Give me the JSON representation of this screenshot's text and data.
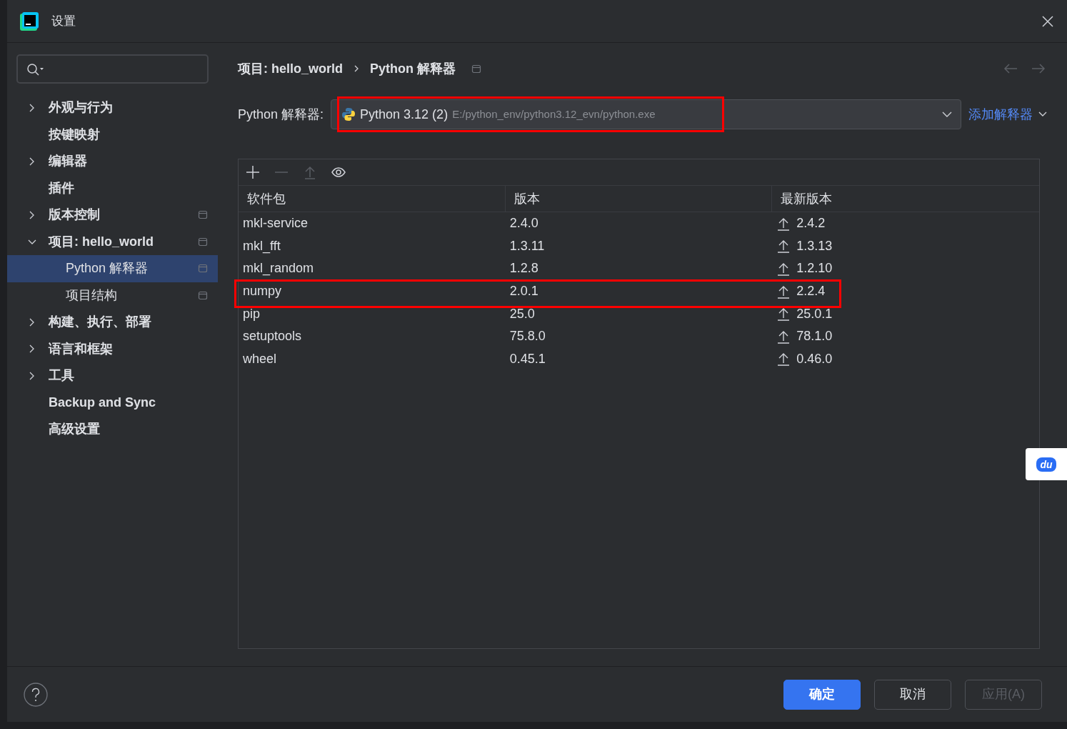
{
  "window": {
    "title": "设置"
  },
  "sidebar": {
    "items": [
      {
        "label": "外观与行为",
        "expanded": false,
        "selected": false,
        "scoped": false
      },
      {
        "label": "按键映射",
        "selected": false,
        "scoped": false
      },
      {
        "label": "编辑器",
        "expanded": false,
        "selected": false,
        "scoped": false
      },
      {
        "label": "插件",
        "selected": false,
        "scoped": false
      },
      {
        "label": "版本控制",
        "expanded": false,
        "selected": false,
        "scoped": true
      },
      {
        "label": "项目: hello_world",
        "expanded": true,
        "selected": false,
        "scoped": true,
        "children": [
          {
            "label": "Python 解释器",
            "selected": true,
            "scoped": true
          },
          {
            "label": "项目结构",
            "selected": false,
            "scoped": true
          }
        ]
      },
      {
        "label": "构建、执行、部署",
        "expanded": false,
        "selected": false,
        "scoped": false
      },
      {
        "label": "语言和框架",
        "expanded": false,
        "selected": false,
        "scoped": false
      },
      {
        "label": "工具",
        "expanded": false,
        "selected": false,
        "scoped": false
      },
      {
        "label": "Backup and Sync",
        "selected": false,
        "scoped": false
      },
      {
        "label": "高级设置",
        "selected": false,
        "scoped": false
      }
    ]
  },
  "breadcrumb": [
    "项目: hello_world",
    "Python 解释器"
  ],
  "interpreter": {
    "label": "Python 解释器:",
    "name": "Python 3.12 (2)",
    "path": "E:/python_env/python3.12_evn/python.exe",
    "highlighted": true,
    "add_link": "添加解释器"
  },
  "toolbar": [
    {
      "kind": "add",
      "disabled": false
    },
    {
      "kind": "remove",
      "disabled": true
    },
    {
      "kind": "upgrade",
      "disabled": true
    },
    {
      "kind": "eye",
      "disabled": false
    }
  ],
  "table": {
    "columns": [
      "软件包",
      "版本",
      "最新版本"
    ],
    "rows": [
      {
        "package": "mkl-service",
        "version": "2.4.0",
        "latest": "2.4.2",
        "highlighted": false
      },
      {
        "package": "mkl_fft",
        "version": "1.3.11",
        "latest": "1.3.13",
        "highlighted": false
      },
      {
        "package": "mkl_random",
        "version": "1.2.8",
        "latest": "1.2.10",
        "highlighted": false
      },
      {
        "package": "numpy",
        "version": "2.0.1",
        "latest": "2.2.4",
        "highlighted": true
      },
      {
        "package": "pip",
        "version": "25.0",
        "latest": "25.0.1",
        "highlighted": false
      },
      {
        "package": "setuptools",
        "version": "75.8.0",
        "latest": "78.1.0",
        "highlighted": false
      },
      {
        "package": "wheel",
        "version": "0.45.1",
        "latest": "0.46.0",
        "highlighted": false
      }
    ]
  },
  "buttons": [
    {
      "label": "确定",
      "kind": "primary",
      "disabled": false
    },
    {
      "label": "取消",
      "kind": "secondary",
      "disabled": false
    },
    {
      "label": "应用(A)",
      "kind": "secondary",
      "disabled": true
    }
  ],
  "floating_badge": {
    "text": "du"
  }
}
